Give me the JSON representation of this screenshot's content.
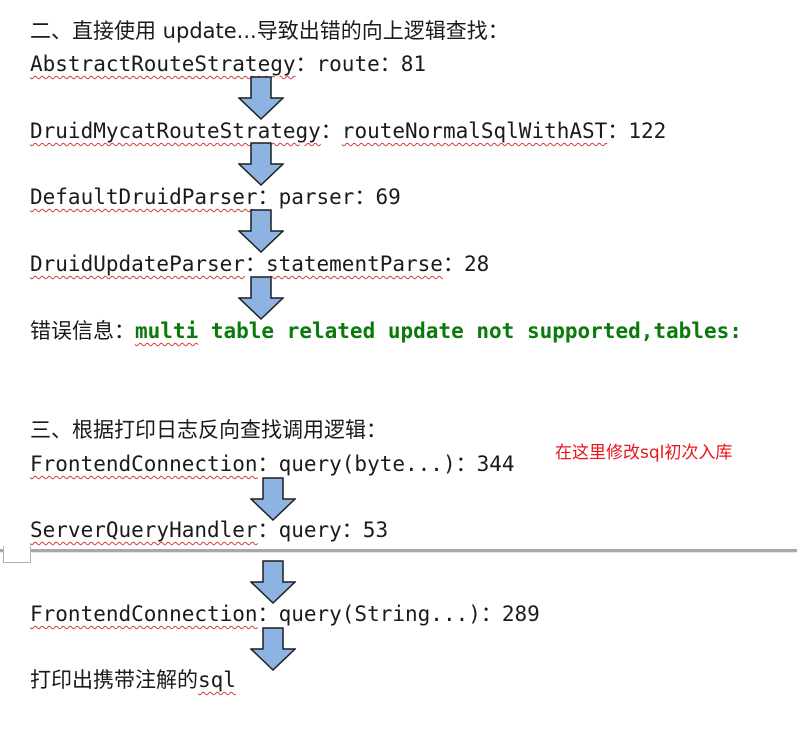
{
  "section2": {
    "heading": "二、直接使用 update...导致出错的向上逻辑查找：",
    "steps": [
      {
        "class_name": "AbstractRouteStrategy",
        "sep": "：",
        "method": "route",
        "sep2": "：",
        "line": "81"
      },
      {
        "class_name": "DruidMycatRouteStrategy",
        "sep": "：",
        "method": "routeNormalSqlWithAST",
        "sep2": "：",
        "line": "122"
      },
      {
        "class_name": "DefaultDruidParser",
        "sep": "：",
        "method": "parser",
        "sep2": "：",
        "line": "69"
      },
      {
        "class_name": "DruidUpdateParser",
        "sep": "：",
        "method": "statementParse",
        "sep2": "：",
        "line": "28"
      }
    ],
    "error_label": "错误信息：",
    "error_word": "multi",
    "error_rest": " table related update not supported,tables:"
  },
  "section3": {
    "heading": "三、根据打印日志反向查找调用逻辑：",
    "steps": [
      {
        "class_name": "FrontendConnection",
        "sep": "：",
        "method": "query(byte...)",
        "sep2": "：",
        "line": "344"
      },
      {
        "class_name": "ServerQueryHandler",
        "sep": "：",
        "method": "query",
        "sep2": "：",
        "line": "53"
      },
      {
        "class_name": "FrontendConnection",
        "sep": "：",
        "method": "query(String...)",
        "sep2": "：",
        "line": "289"
      }
    ],
    "final_label": "打印出携带注解的",
    "final_code": "sql",
    "note": "在这里修改sql初次入库"
  },
  "colors": {
    "text": "#1a1a1a",
    "error": "#0a7a0a",
    "note": "#e8141c",
    "arrow_fill": "#8db3e2",
    "arrow_stroke": "#1f1f1f",
    "spell_underline": "#d23a3a"
  }
}
